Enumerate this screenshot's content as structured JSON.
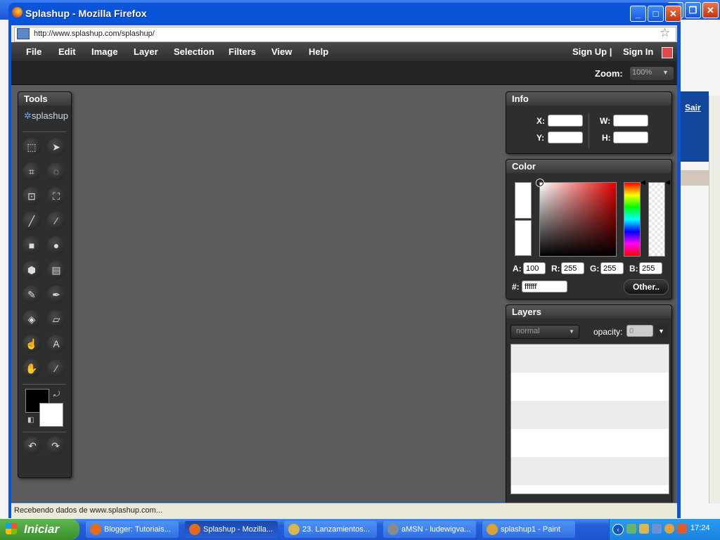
{
  "window": {
    "title": "Splashup - Mozilla Firefox",
    "url": "http://www.splashup.com/splashup/"
  },
  "background": {
    "link": "Sair"
  },
  "menu": {
    "items": [
      "File",
      "Edit",
      "Image",
      "Layer",
      "Selection",
      "Filters",
      "View",
      "Help"
    ],
    "sign_up": "Sign Up |",
    "sign_in": "Sign In"
  },
  "zoom": {
    "label": "Zoom:",
    "value": "100%"
  },
  "tools": {
    "title": "Tools",
    "logo": "splashup",
    "icons": [
      "marquee-select",
      "move-arrow",
      "crop",
      "lasso",
      "transform",
      "free-transform",
      "pencil",
      "line",
      "rectangle",
      "ellipse",
      "polygon",
      "gradient",
      "brush",
      "pen",
      "fill-bucket",
      "eraser",
      "smudge",
      "text",
      "hand",
      "eyedropper"
    ],
    "text_tool_glyph": "A",
    "colors": {
      "foreground": "#000000",
      "background": "#ffffff"
    }
  },
  "info": {
    "title": "Info",
    "x_label": "X:",
    "y_label": "Y:",
    "w_label": "W:",
    "h_label": "H:"
  },
  "color": {
    "title": "Color",
    "a_label": "A:",
    "a": "100",
    "r_label": "R:",
    "r": "255",
    "g_label": "G:",
    "g": "255",
    "b_label": "B:",
    "b": "255",
    "hex_label": "#:",
    "hex": "ffffff",
    "other_button": "Other.."
  },
  "layers": {
    "title": "Layers",
    "blend_mode": "normal",
    "opacity_label": "opacity:",
    "opacity_value": "0"
  },
  "status": {
    "text": "Recebendo dados de www.splashup.com..."
  },
  "taskbar": {
    "start": "Iniciar",
    "tasks": [
      {
        "label": "Blogger: Tutoriais...",
        "icon_color": "#e46b1d",
        "active": false
      },
      {
        "label": "Splashup - Mozilla...",
        "icon_color": "#e46b1d",
        "active": true
      },
      {
        "label": "23. Lanzamientos...",
        "icon_color": "#d9b74a",
        "active": false
      },
      {
        "label": "aMSN - ludewigva...",
        "icon_color": "#8a8a8a",
        "active": false
      },
      {
        "label": "splashup1 - Paint",
        "icon_color": "#d9a437",
        "active": false
      }
    ],
    "clock": "17:24"
  }
}
